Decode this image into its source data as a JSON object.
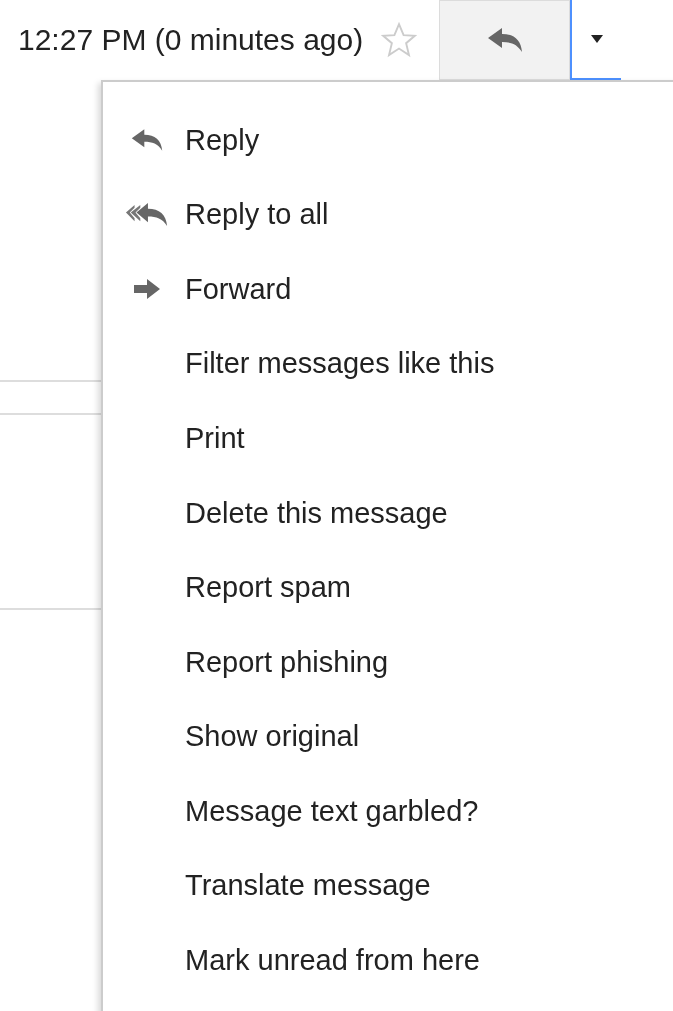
{
  "header": {
    "time": "12:27 PM (0 minutes ago)",
    "starred": false
  },
  "menu": {
    "open": true,
    "items": [
      {
        "label": "Reply",
        "kind": "reply"
      },
      {
        "label": "Reply to all",
        "kind": "reply-all"
      },
      {
        "label": "Forward",
        "kind": "forward"
      },
      {
        "label": "Filter messages like this",
        "kind": "plain"
      },
      {
        "label": "Print",
        "kind": "plain"
      },
      {
        "label": "Delete this message",
        "kind": "plain"
      },
      {
        "label": "Report spam",
        "kind": "plain"
      },
      {
        "label": "Report phishing",
        "kind": "plain"
      },
      {
        "label": "Show original",
        "kind": "plain"
      },
      {
        "label": "Message text garbled?",
        "kind": "plain"
      },
      {
        "label": "Translate message",
        "kind": "plain"
      },
      {
        "label": "Mark unread from here",
        "kind": "plain"
      }
    ]
  }
}
